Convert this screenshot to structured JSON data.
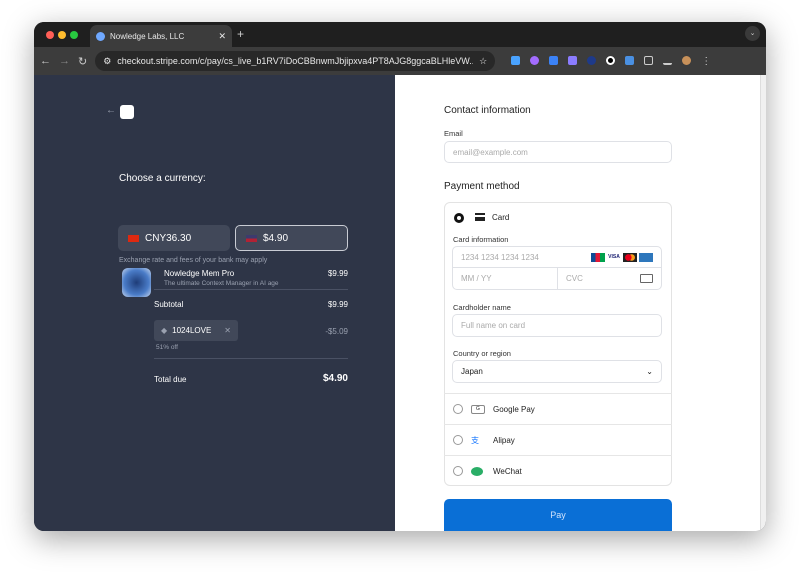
{
  "browser": {
    "tab_title": "Nowledge Labs, LLC",
    "url": "checkout.stripe.com/c/pay/cs_live_b1RV7iDoCBBnwmJbjipxva4PT8AJG8ggcaBLHleVW..."
  },
  "summary": {
    "currency_heading": "Choose a currency:",
    "currencies": [
      {
        "label": "CNY36.30",
        "flag": "CN",
        "selected": false
      },
      {
        "label": "$4.90",
        "flag": "US",
        "selected": true
      }
    ],
    "exchange_note": "Exchange rate and fees of your bank may apply",
    "product": {
      "name": "Nowledge Mem Pro",
      "description": "The ultimate Context Manager in AI age",
      "price": "$9.99"
    },
    "subtotal_label": "Subtotal",
    "subtotal": "$9.99",
    "promo_code": "1024LOVE",
    "discount": "-$5.09",
    "discount_note": "51% off",
    "total_label": "Total due",
    "total": "$4.90"
  },
  "form": {
    "contact_heading": "Contact information",
    "email_label": "Email",
    "email_placeholder": "email@example.com",
    "payment_heading": "Payment method",
    "card_label": "Card",
    "card_info_label": "Card information",
    "card_number_placeholder": "1234 1234 1234 1234",
    "expiry_placeholder": "MM / YY",
    "cvc_placeholder": "CVC",
    "card_brands": [
      "JCB",
      "VISA",
      "Mastercard",
      "Amex"
    ],
    "cardholder_label": "Cardholder name",
    "cardholder_placeholder": "Full name on card",
    "country_label": "Country or region",
    "country_value": "Japan",
    "other_methods": [
      "Google Pay",
      "Alipay",
      "WeChat"
    ],
    "pay_label": "Pay",
    "pay_color": "#0a6fd6"
  }
}
